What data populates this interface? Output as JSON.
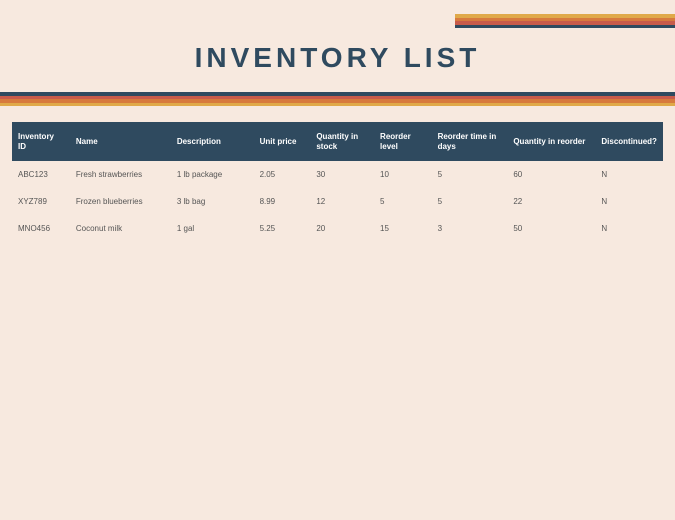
{
  "header": {
    "title": "INVENTORY LIST"
  },
  "table": {
    "columns": [
      "Inventory ID",
      "Name",
      "Description",
      "Unit price",
      "Quantity in stock",
      "Reorder level",
      "Reorder time in days",
      "Quantity in reorder",
      "Discontinued?"
    ],
    "rows": [
      {
        "id": "ABC123",
        "name": "Fresh strawberries",
        "desc": "1 lb package",
        "price": "2.05",
        "qty": "30",
        "reorder": "10",
        "time": "5",
        "qir": "60",
        "disc": "N"
      },
      {
        "id": "XYZ789",
        "name": "Frozen blueberries",
        "desc": "3 lb bag",
        "price": "8.99",
        "qty": "12",
        "reorder": "5",
        "time": "5",
        "qir": "22",
        "disc": "N"
      },
      {
        "id": "MNO456",
        "name": "Coconut milk",
        "desc": "1 gal",
        "price": "5.25",
        "qty": "20",
        "reorder": "15",
        "time": "3",
        "qir": "50",
        "disc": "N"
      }
    ]
  }
}
